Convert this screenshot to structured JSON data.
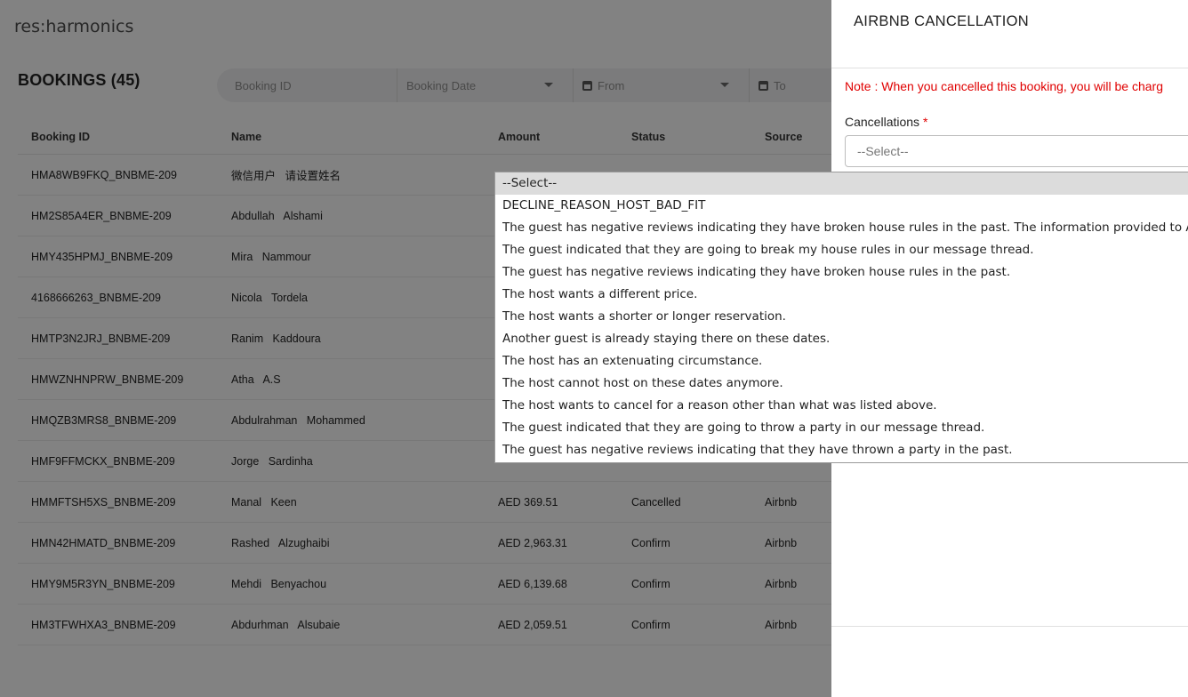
{
  "app": {
    "logo": "res:harmonics"
  },
  "page": {
    "title": "BOOKINGS (45)"
  },
  "filters": {
    "booking_id_placeholder": "Booking ID",
    "booking_date": "Booking Date",
    "from": "From",
    "to": "To"
  },
  "table": {
    "headers": [
      "Booking ID",
      "Name",
      "Amount",
      "Status",
      "Source"
    ],
    "rows": [
      {
        "id": "HMA8WB9FKQ_BNBME-209",
        "first": "微信用户",
        "last": "请设置姓名",
        "amount": "",
        "status": "",
        "source": ""
      },
      {
        "id": "HM2S85A4ER_BNBME-209",
        "first": "Abdullah",
        "last": "Alshami",
        "amount": "",
        "status": "",
        "source": ""
      },
      {
        "id": "HMY435HPMJ_BNBME-209",
        "first": "Mira",
        "last": "Nammour",
        "amount": "",
        "status": "",
        "source": ""
      },
      {
        "id": "4168666263_BNBME-209",
        "first": "Nicola",
        "last": "Tordela",
        "amount": "",
        "status": "",
        "source": ""
      },
      {
        "id": "HMTP3N2JRJ_BNBME-209",
        "first": "Ranim",
        "last": "Kaddoura",
        "amount": "",
        "status": "",
        "source": ""
      },
      {
        "id": "HMWZNHNPRW_BNBME-209",
        "first": "Atha",
        "last": "A.S",
        "amount": "",
        "status": "",
        "source": ""
      },
      {
        "id": "HMQZB3MRS8_BNBME-209",
        "first": "Abdulrahman",
        "last": "Mohammed",
        "amount": "",
        "status": "",
        "source": ""
      },
      {
        "id": "HMF9FFMCKX_BNBME-209",
        "first": "Jorge",
        "last": "Sardinha",
        "amount": "",
        "status": "",
        "source": ""
      },
      {
        "id": "HMMFTSH5XS_BNBME-209",
        "first": "Manal",
        "last": "Keen",
        "amount": "AED 369.51",
        "status": "Cancelled",
        "source": "Airbnb"
      },
      {
        "id": "HMN42HMATD_BNBME-209",
        "first": "Rashed",
        "last": "Alzughaibi",
        "amount": "AED 2,963.31",
        "status": "Confirm",
        "source": "Airbnb"
      },
      {
        "id": "HMY9M5R3YN_BNBME-209",
        "first": "Mehdi",
        "last": "Benyachou",
        "amount": "AED 6,139.68",
        "status": "Confirm",
        "source": "Airbnb"
      },
      {
        "id": "HM3TFWHXA3_BNBME-209",
        "first": "Abdurhman",
        "last": "Alsubaie",
        "amount": "AED 2,059.51",
        "status": "Confirm",
        "source": "Airbnb"
      }
    ]
  },
  "drawer": {
    "title": "AIRBNB CANCELLATION",
    "note": "Note : When you cancelled this booking, you will be charg",
    "field_label": "Cancellations",
    "required_mark": "*",
    "select_value": "--Select--"
  },
  "dropdown": {
    "options": [
      "--Select--",
      "DECLINE_REASON_HOST_BAD_FIT",
      "The guest has negative reviews indicating they have broken house rules in the past. The information provided to Airbnb we",
      "The guest indicated that they are going to break my house rules in our message thread.",
      "The guest has negative reviews indicating they have broken house rules in the past.",
      "The host wants a different price.",
      "The host wants a shorter or longer reservation.",
      "Another guest is already staying there on these dates.",
      "The host has an extenuating circumstance.",
      "The host cannot host on these dates anymore.",
      "The host wants to cancel for a reason other than what was listed above.",
      "The guest indicated that they are going to throw a party in our message thread.",
      "The guest has negative reviews indicating that they have thrown a party in the past."
    ]
  }
}
